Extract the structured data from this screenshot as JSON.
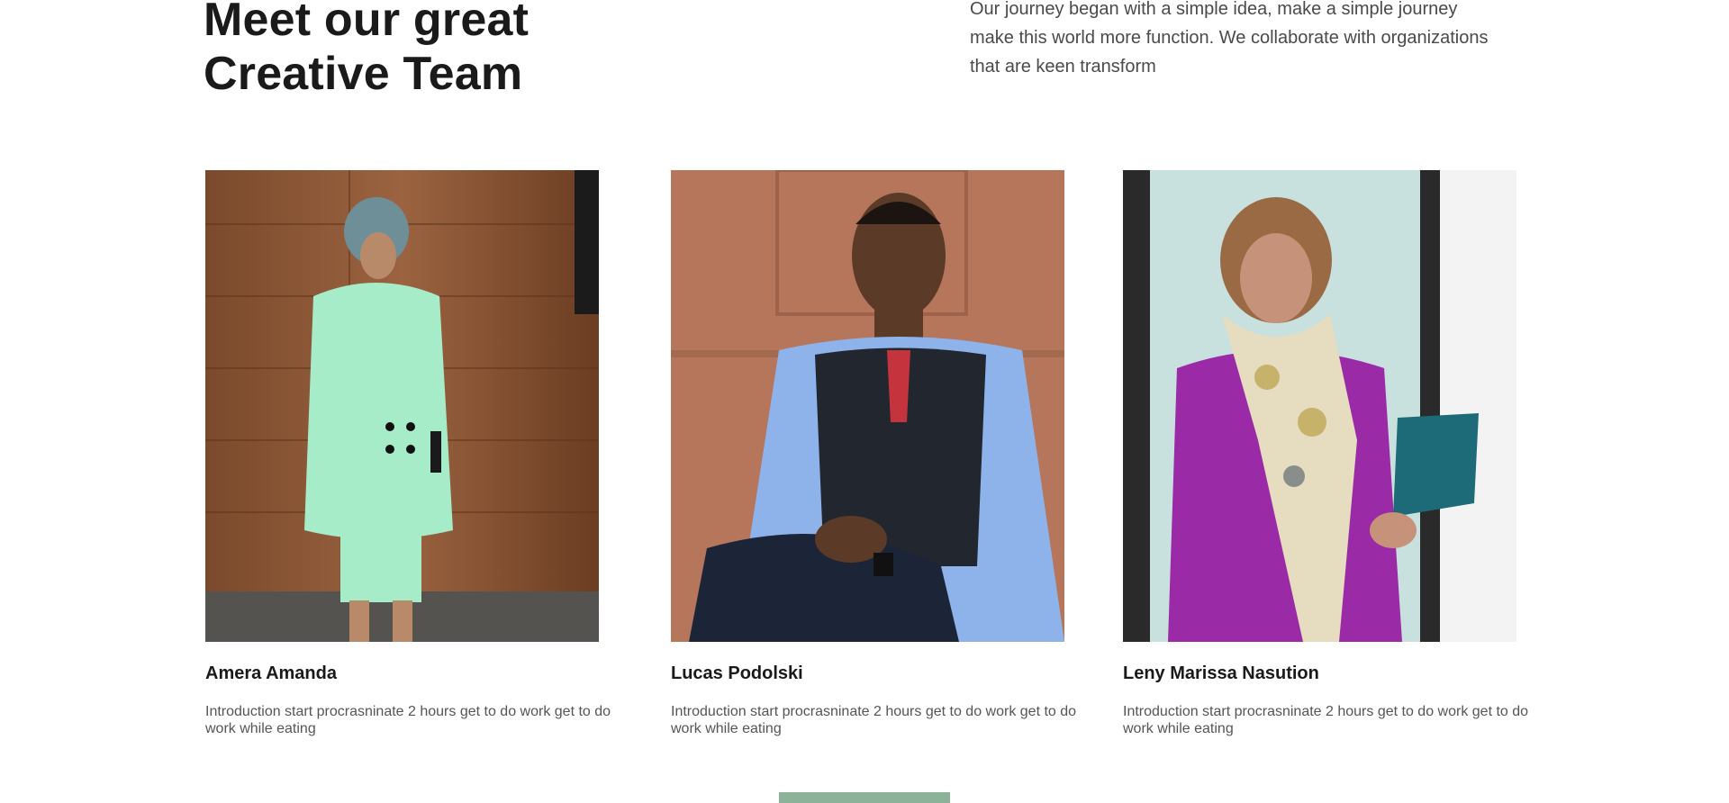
{
  "header": {
    "title_line1": "Meet our great",
    "title_line2": "Creative Team",
    "intro": "Our journey began with a simple idea, make a simple journey make this world more function. We collaborate with organizations that are keen transform"
  },
  "team": [
    {
      "name": "Amera Amanda",
      "intro": "Introduction start procrasninate 2 hours get to do work get to do work while eating"
    },
    {
      "name": "Lucas Podolski",
      "intro": "Introduction start procrasninate 2 hours get to do work get to do work while eating"
    },
    {
      "name": "Leny Marissa Nasution",
      "intro": "Introduction start procrasninate 2 hours get to do work get to do work while eating"
    }
  ],
  "colors": {
    "accent": "#8db29a",
    "heading": "#1a1a1a",
    "body_text": "#555555"
  }
}
